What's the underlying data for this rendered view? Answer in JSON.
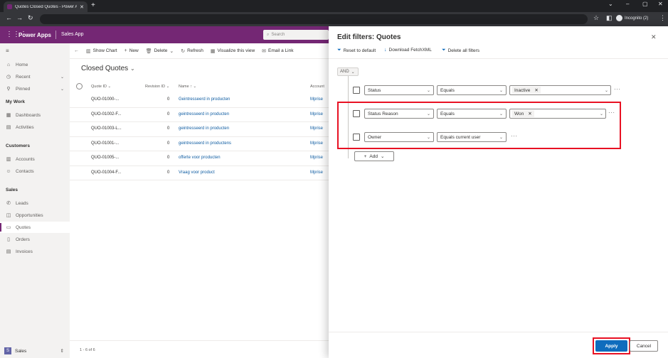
{
  "browser": {
    "tab_title": "Quotes Closed Quotes - Power A",
    "new_tab_icon": "+",
    "incognito_label": "Incognito (2)"
  },
  "header": {
    "app_name": "Power Apps",
    "app_subtitle": "Sales App",
    "search_placeholder": "Search"
  },
  "sidebar": {
    "top": [
      {
        "label": "Home",
        "icon": "home-icon"
      },
      {
        "label": "Recent",
        "icon": "clock-icon"
      },
      {
        "label": "Pinned",
        "icon": "pin-icon"
      }
    ],
    "sections": [
      {
        "title": "My Work",
        "items": [
          "Dashboards",
          "Activities"
        ]
      },
      {
        "title": "Customers",
        "items": [
          "Accounts",
          "Contacts"
        ]
      },
      {
        "title": "Sales",
        "items": [
          "Leads",
          "Opportunities",
          "Quotes",
          "Orders",
          "Invoices"
        ]
      }
    ],
    "active_item": "Quotes",
    "area_badge": "S",
    "area_label": "Sales"
  },
  "commands": [
    "Show Chart",
    "New",
    "Delete",
    "Refresh",
    "Visualize this view",
    "Email a Link"
  ],
  "grid": {
    "view_title": "Closed Quotes",
    "columns": [
      "Quote ID",
      "Revision ID",
      "Name",
      "Account"
    ],
    "rows": [
      {
        "quote_id": "QUO-01000-...",
        "revision": "0",
        "name": "Geintresseerd in producten",
        "account": "Mprise"
      },
      {
        "quote_id": "QUO-01002-F...",
        "revision": "0",
        "name": "geintresseerd in producten",
        "account": "Mprise"
      },
      {
        "quote_id": "QUO-01003-L...",
        "revision": "0",
        "name": "geintresseerd in producten",
        "account": "Mprise"
      },
      {
        "quote_id": "QUO-01001-...",
        "revision": "0",
        "name": "geintresseerd in productens",
        "account": "Mprise"
      },
      {
        "quote_id": "QUO-01005-...",
        "revision": "0",
        "name": "offerte voor producten",
        "account": "Mprise"
      },
      {
        "quote_id": "QUO-01004-F...",
        "revision": "0",
        "name": "Vraag voor product",
        "account": "Mprise"
      }
    ],
    "footer": "1 - 6 of 6"
  },
  "panel": {
    "title": "Edit filters: Quotes",
    "tools": [
      "Reset to default",
      "Download FetchXML",
      "Delete all filters"
    ],
    "group_operator": "AND",
    "filters": [
      {
        "field": "Status",
        "operator": "Equals",
        "value": "Inactive"
      },
      {
        "field": "Status Reason",
        "operator": "Equals",
        "value": "Won"
      },
      {
        "field": "Owner",
        "operator": "Equals current user",
        "value": ""
      }
    ],
    "add_label": "Add",
    "apply_label": "Apply",
    "cancel_label": "Cancel"
  },
  "colors": {
    "brand": "#742774",
    "primary": "#0f6cbd",
    "highlight": "#e81123"
  }
}
